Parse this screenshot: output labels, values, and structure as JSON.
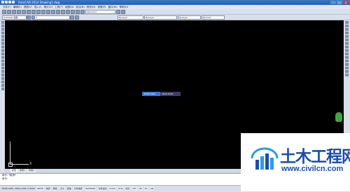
{
  "window": {
    "title": "AutoCAD 2014  Drawing1.dwg"
  },
  "menus": [
    "文件(F)",
    "编辑(E)",
    "视图(V)",
    "插入(I)",
    "格式(O)",
    "工具(T)",
    "绘图(D)",
    "标注(N)",
    "修改(M)",
    "参数(P)",
    "窗口(W)",
    "帮助(H)"
  ],
  "toolbar": {
    "workspace": "AutoCAD 经典",
    "layer": "0",
    "color": "ByLayer",
    "linetype": "ByLayer",
    "lineweight": "ByLayer",
    "plotstyle": "ByColor",
    "textstyle": "Standard"
  },
  "canvas": {
    "coord_tooltip_1": "-8596.0281",
    "coord_tooltip_2": "4840.1526",
    "ucs_y": "Y",
    "ucs_x": "X"
  },
  "tabs": [
    "模型",
    "布局1",
    "布局2"
  ],
  "command": {
    "line1": "命令: *取消*",
    "line2": "命令:"
  },
  "status": {
    "coords": "-8596.0281, 4840.1526, 0.0000",
    "buttons": [
      "INFER",
      "捕捉",
      "栅格",
      "正交",
      "极轴",
      "对象捕捉",
      "3DOSNAP",
      "对象追踪",
      "DUCS",
      "DYN",
      "线宽",
      "TPY",
      "QP",
      "SC",
      "AM"
    ]
  },
  "watermark": {
    "title": "土木工程网",
    "url": "www.civilcn.com"
  },
  "colors": {
    "canvas": "#000000",
    "watermark_blue": "#1a4fa8"
  }
}
